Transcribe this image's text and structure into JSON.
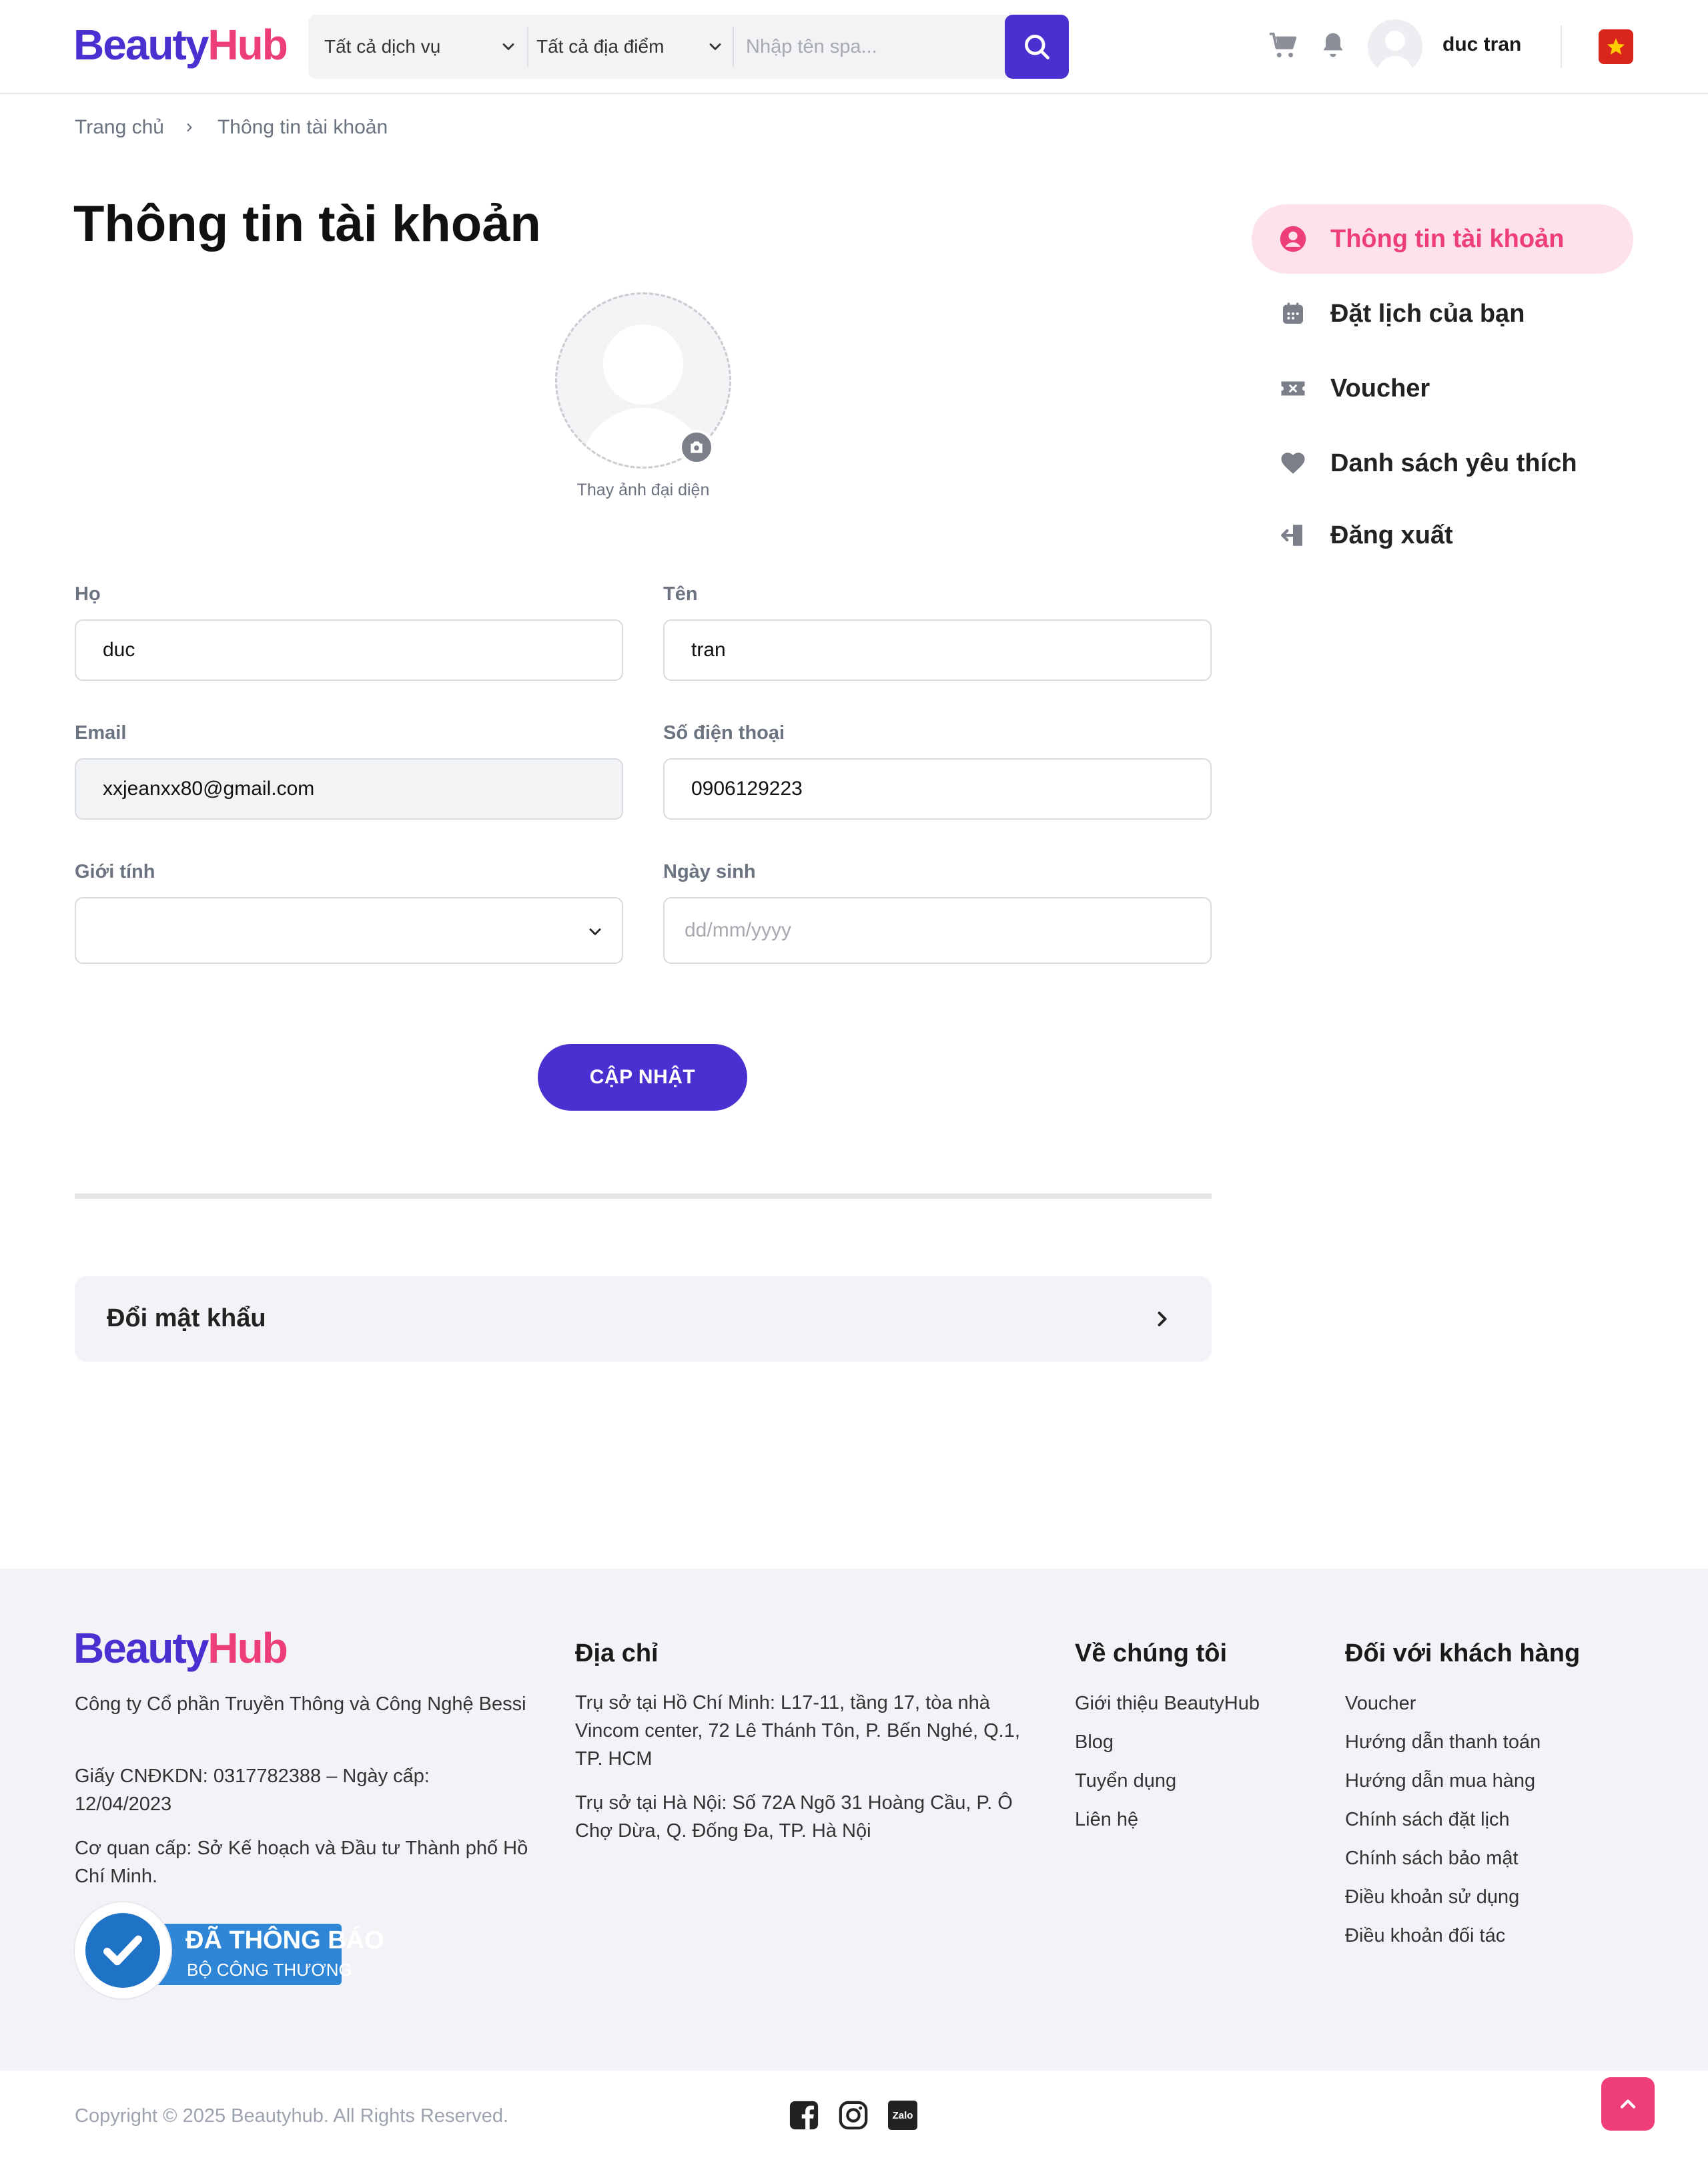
{
  "header": {
    "logo_part1": "Beauty",
    "logo_part2": "Hub",
    "service_select": "Tất cả dịch vụ",
    "location_select": "Tất cả địa điểm",
    "search_placeholder": "Nhập tên spa...",
    "username": "duc tran"
  },
  "breadcrumb": {
    "home": "Trang chủ",
    "current": "Thông tin tài khoản"
  },
  "page": {
    "title": "Thông tin tài khoản",
    "avatar_caption": "Thay ảnh đại diện"
  },
  "form": {
    "last_name_label": "Họ",
    "last_name_value": "duc",
    "first_name_label": "Tên",
    "first_name_value": "tran",
    "email_label": "Email",
    "email_value": "xxjeanxx80@gmail.com",
    "phone_label": "Số điện thoại",
    "phone_value": "0906129223",
    "gender_label": "Giới tính",
    "gender_value": "",
    "birthday_label": "Ngày sinh",
    "birthday_placeholder": "dd/mm/yyyy",
    "update_button": "CẬP NHẬT"
  },
  "password": {
    "label": "Đổi mật khẩu"
  },
  "sidebar": {
    "items": [
      {
        "label": "Thông tin tài khoản",
        "icon": "user-circle-icon",
        "active": true
      },
      {
        "label": "Đặt lịch của bạn",
        "icon": "calendar-icon",
        "active": false
      },
      {
        "label": "Voucher",
        "icon": "ticket-icon",
        "active": false
      },
      {
        "label": "Danh sách yêu thích",
        "icon": "heart-icon",
        "active": false
      },
      {
        "label": "Đăng xuất",
        "icon": "logout-icon",
        "active": false
      }
    ]
  },
  "footer": {
    "logo_part1": "Beauty",
    "logo_part2": "Hub",
    "company": "Công ty Cổ phần Truyền Thông và Công Nghệ Bessi",
    "license": "Giấy CNĐKDN: 0317782388 – Ngày cấp: 12/04/2023",
    "authority": "Cơ quan cấp: Sở Kế hoạch và Đầu tư Thành phố Hồ Chí Minh.",
    "badge_line1": "ĐÃ THÔNG BÁO",
    "badge_line2": "BỘ CÔNG THƯƠNG",
    "address_heading": "Địa chỉ",
    "address_hcm": "Trụ sở tại Hồ Chí Minh: L17-11, tầng 17, tòa nhà Vincom center, 72 Lê Thánh Tôn, P. Bến Nghé, Q.1, TP. HCM",
    "address_hn": "Trụ sở tại Hà Nội: Số 72A Ngõ 31 Hoàng Cầu, P. Ô Chợ Dừa, Q. Đống Đa, TP. Hà Nội",
    "about_heading": "Về chúng tôi",
    "about_links": [
      "Giới thiệu BeautyHub",
      "Blog",
      "Tuyển dụng",
      "Liên hệ"
    ],
    "customer_heading": "Đối với khách hàng",
    "customer_links": [
      "Voucher",
      "Hướng dẫn thanh toán",
      "Hướng dẫn mua hàng",
      "Chính sách đặt lịch",
      "Chính sách bảo mật",
      "Điều khoản sử dụng",
      "Điều khoản đối tác"
    ],
    "copyright": "Copyright © 2025 Beautyhub. All Rights Reserved.",
    "zalo": "Zalo"
  },
  "colors": {
    "primary": "#4b2fd1",
    "accent": "#ee3e7a",
    "active_bg": "#fde2ea"
  }
}
